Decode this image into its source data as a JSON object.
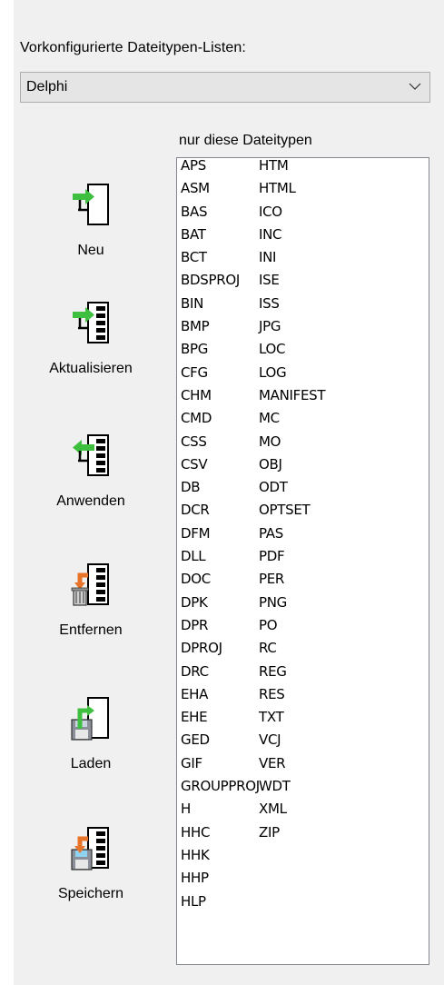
{
  "preset": {
    "label": "Vorkonfigurierte Dateitypen-Listen:",
    "selected": "Delphi"
  },
  "list_label": "nur diese Dateitypen",
  "tools": [
    {
      "label": "Neu",
      "icon": "new-list-icon"
    },
    {
      "label": "Aktualisieren",
      "icon": "update-list-icon"
    },
    {
      "label": "Anwenden",
      "icon": "apply-list-icon"
    },
    {
      "label": "Entfernen",
      "icon": "delete-list-icon"
    },
    {
      "label": "Laden",
      "icon": "load-list-icon"
    },
    {
      "label": "Speichern",
      "icon": "save-list-icon"
    }
  ],
  "file_types": {
    "column1": [
      "APS",
      "ASM",
      "BAS",
      "BAT",
      "BCT",
      "BDSPROJ",
      "BIN",
      "BMP",
      "BPG",
      "CFG",
      "CHM",
      "CMD",
      "CSS",
      "CSV",
      "DB",
      "DCR",
      "DFM",
      "DLL",
      "DOC",
      "DPK",
      "DPR",
      "DPROJ",
      "DRC",
      "EHA",
      "EHE",
      "GED",
      "GIF",
      "GROUPPROJ",
      "H",
      "HHC",
      "HHK",
      "HHP",
      "HLP"
    ],
    "column2": [
      "HTM",
      "HTML",
      "ICO",
      "INC",
      "INI",
      "ISE",
      "ISS",
      "JPG",
      "LOC",
      "LOG",
      "MANIFEST",
      "MC",
      "MO",
      "OBJ",
      "ODT",
      "OPTSET",
      "PAS",
      "PDF",
      "PER",
      "PNG",
      "PO",
      "RC",
      "REG",
      "RES",
      "TXT",
      "VCJ",
      "VER",
      "WDT",
      "XML",
      "ZIP"
    ]
  },
  "colors": {
    "arrow_green": "#3fbf3f",
    "arrow_orange": "#e8742a",
    "panel_bg": "#f0f0f0"
  }
}
